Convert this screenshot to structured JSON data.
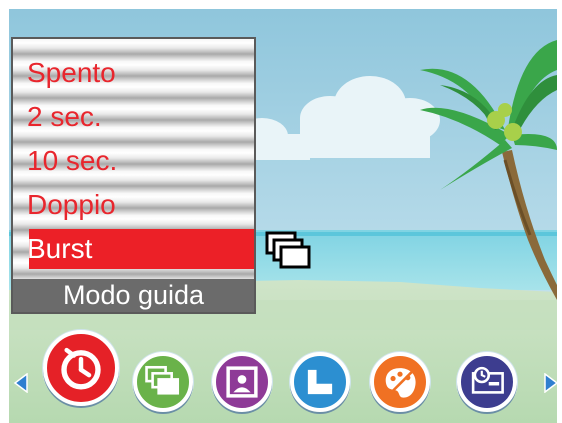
{
  "menu": {
    "footer": "Modo guida",
    "items": [
      {
        "label": "Spento"
      },
      {
        "label": "2 sec."
      },
      {
        "label": "10 sec."
      },
      {
        "label": "Doppio"
      },
      {
        "label": "Burst",
        "selected": true
      }
    ]
  },
  "mode_bar": {
    "active": "self-timer",
    "buttons": [
      {
        "name": "self-timer",
        "color": "#e52127",
        "active": true
      },
      {
        "name": "burst-mode",
        "color": "#6ab24a"
      },
      {
        "name": "portrait-frame",
        "color": "#8e3a97"
      },
      {
        "name": "print-size",
        "color": "#2c8fd1"
      },
      {
        "name": "effects",
        "color": "#f07123"
      },
      {
        "name": "date-imprint",
        "color": "#3d3d8f"
      }
    ]
  },
  "theme": {
    "selected_bg": "#ec2027",
    "menu_text": "#e8262d",
    "footer_bg": "#6b6b6b"
  }
}
